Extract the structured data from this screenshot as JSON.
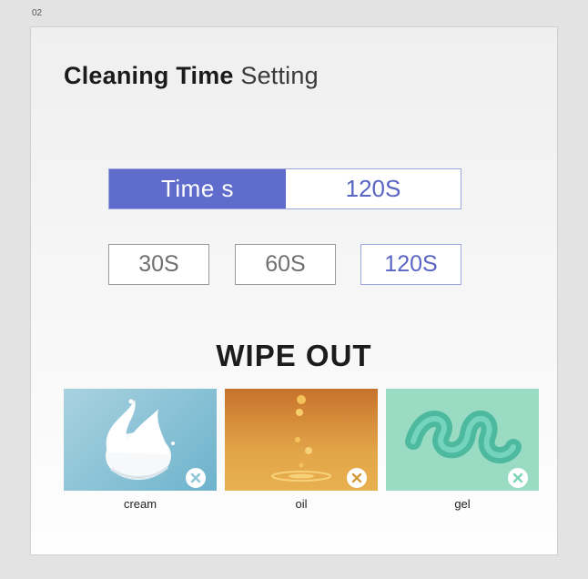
{
  "frame_label": "02",
  "title": {
    "bold": "Cleaning Time",
    "light": "Setting"
  },
  "time": {
    "label": "Time s",
    "value": "120S"
  },
  "options": [
    {
      "label": "30S",
      "selected": false
    },
    {
      "label": "60S",
      "selected": false
    },
    {
      "label": "120S",
      "selected": true
    }
  ],
  "wipe_title": "WIPE OUT",
  "products": [
    {
      "name": "cream",
      "icon": "cream-splash-image",
      "close_color": "#8cc6d8"
    },
    {
      "name": "oil",
      "icon": "oil-drops-image",
      "close_color": "#d59a3c"
    },
    {
      "name": "gel",
      "icon": "gel-swirl-image",
      "close_color": "#7dd3b9"
    }
  ],
  "colors": {
    "accent": "#5f6ccc",
    "accent_text": "#5964c3"
  }
}
